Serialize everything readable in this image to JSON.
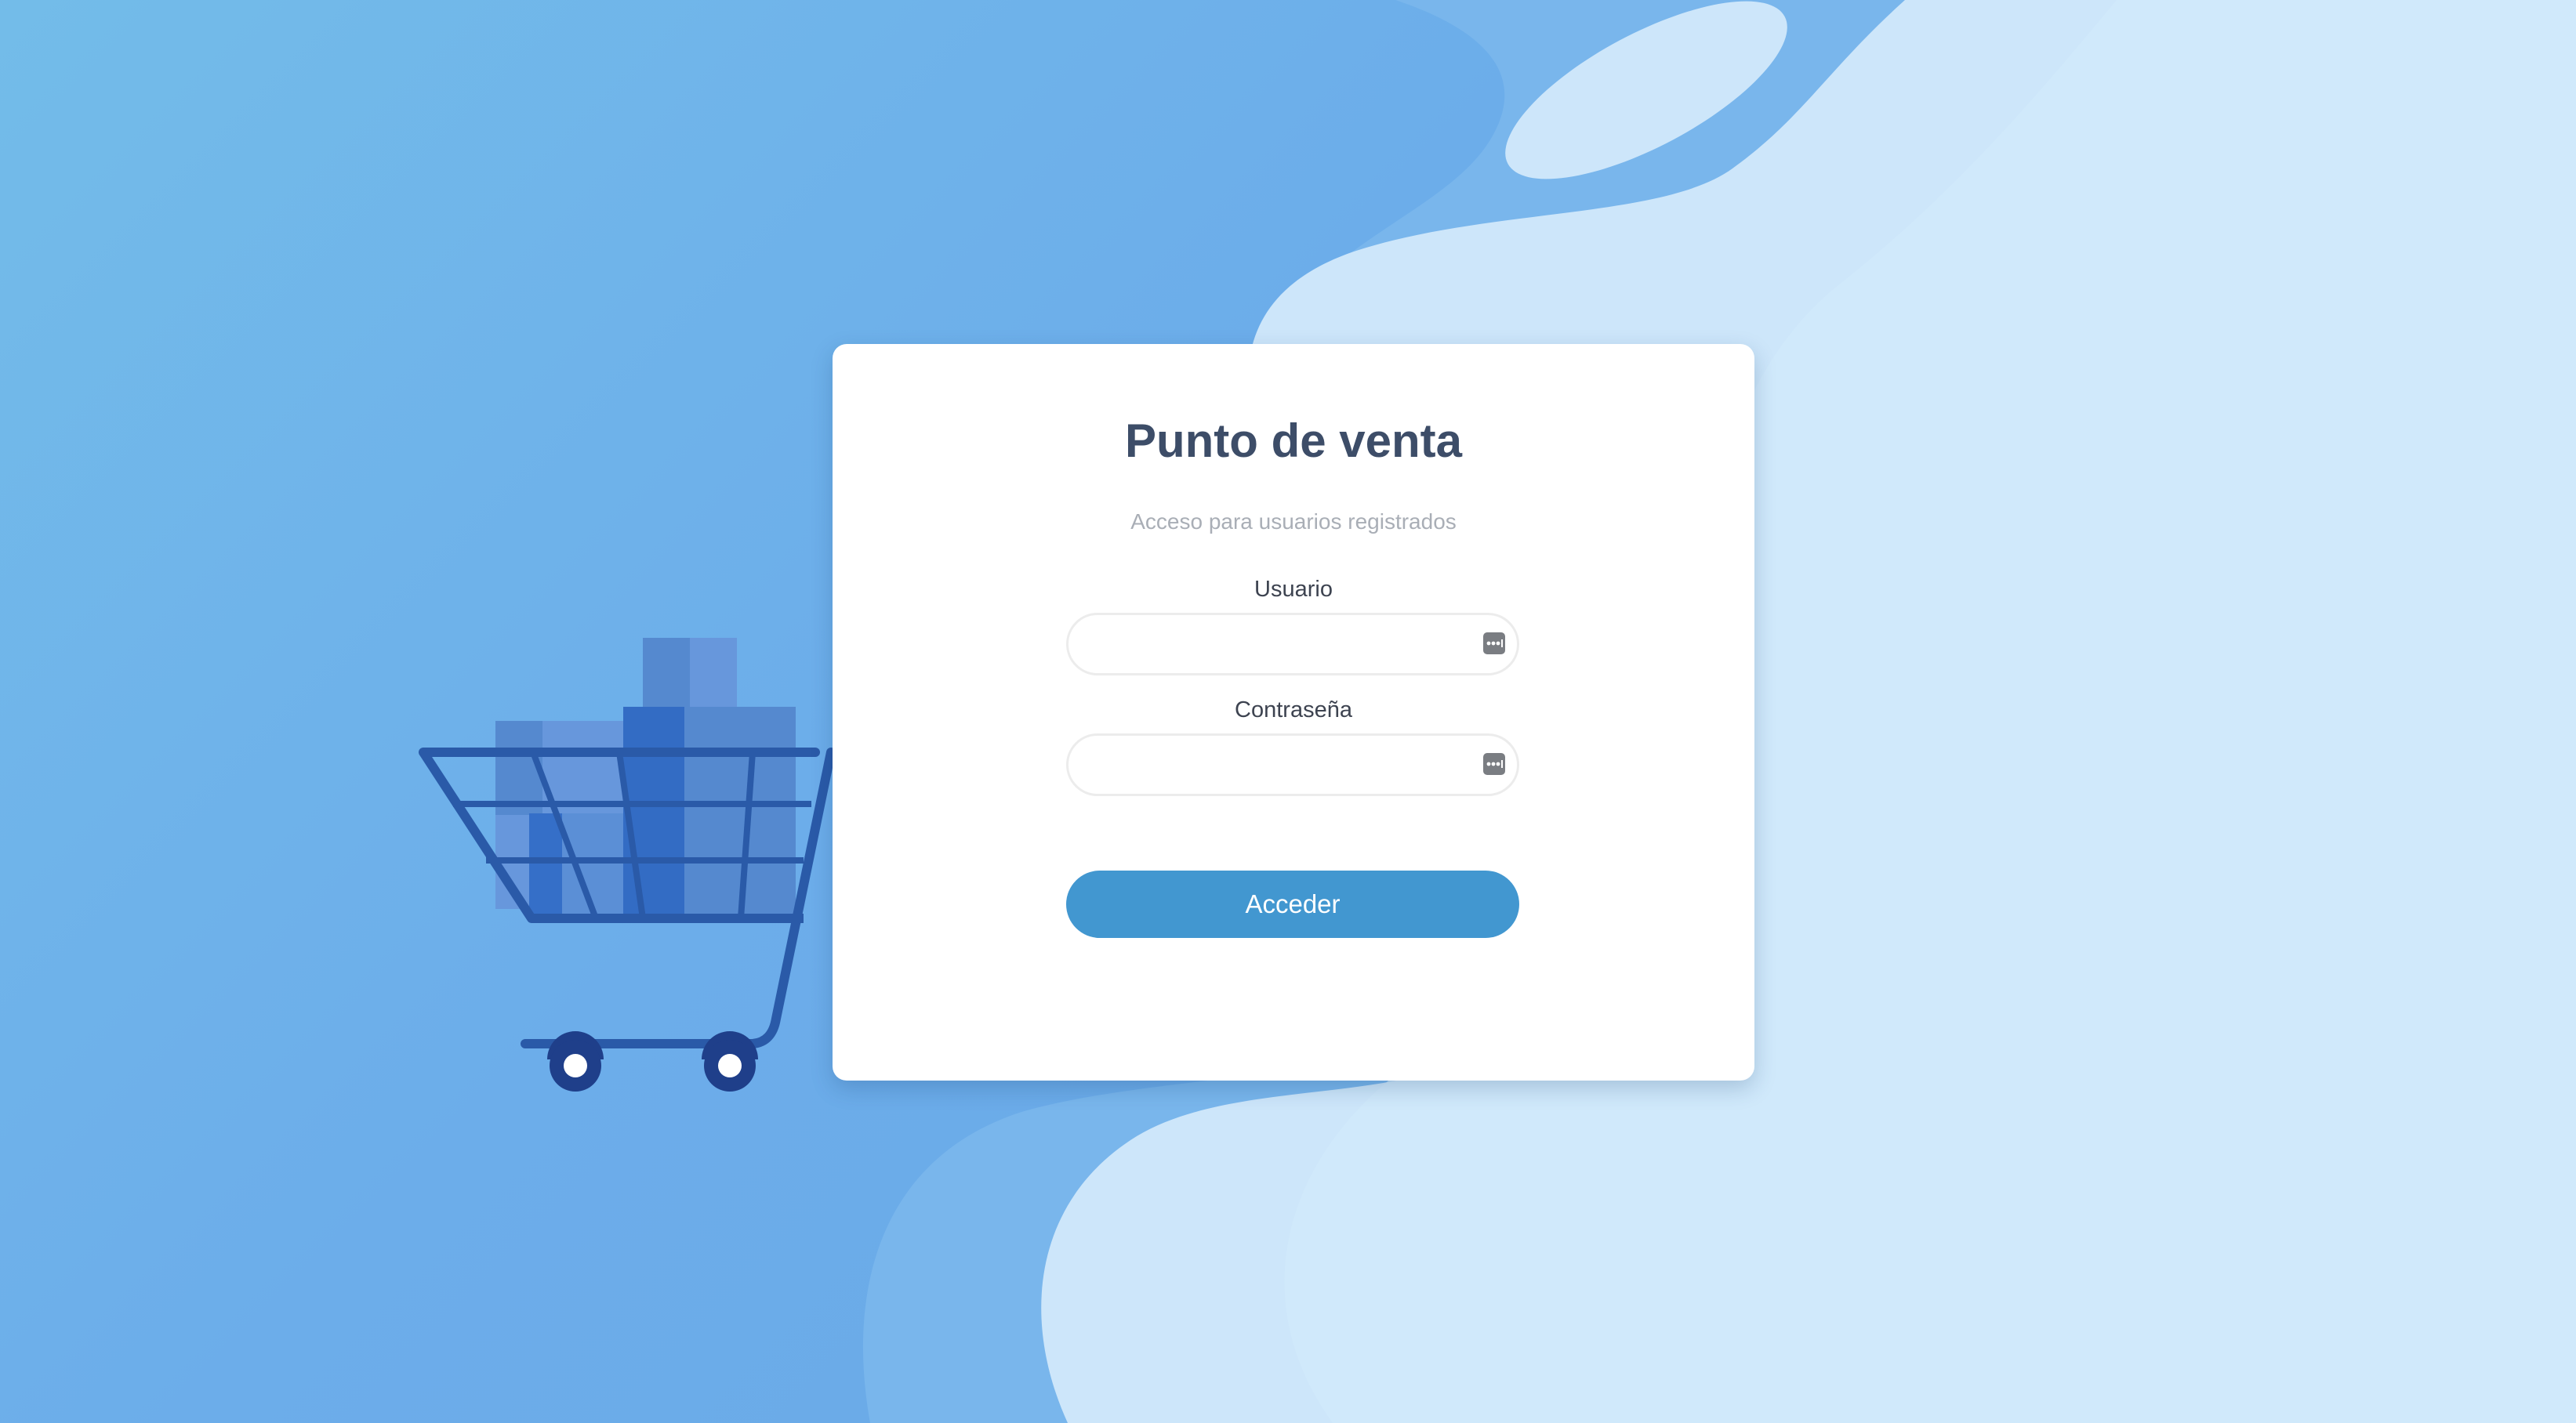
{
  "login": {
    "title": "Punto de venta",
    "subtitle": "Acceso para usuarios registrados",
    "username": {
      "label": "Usuario",
      "value": "",
      "placeholder": "",
      "icon": "password-manager-key-icon"
    },
    "password": {
      "label": "Contraseña",
      "value": "",
      "placeholder": "",
      "icon": "password-manager-key-icon"
    },
    "submit_label": "Acceder"
  },
  "illustration": {
    "icon": "shopping-cart-icon"
  },
  "colors": {
    "background_blue": "#6cadea",
    "light_wave": "#cde6fa",
    "title_text": "#3d4d68",
    "subtitle_text": "#a9aeb6",
    "button": "#4297d0",
    "cart_frame": "#2a5aa8",
    "cart_wheel": "#1f3f8a"
  }
}
